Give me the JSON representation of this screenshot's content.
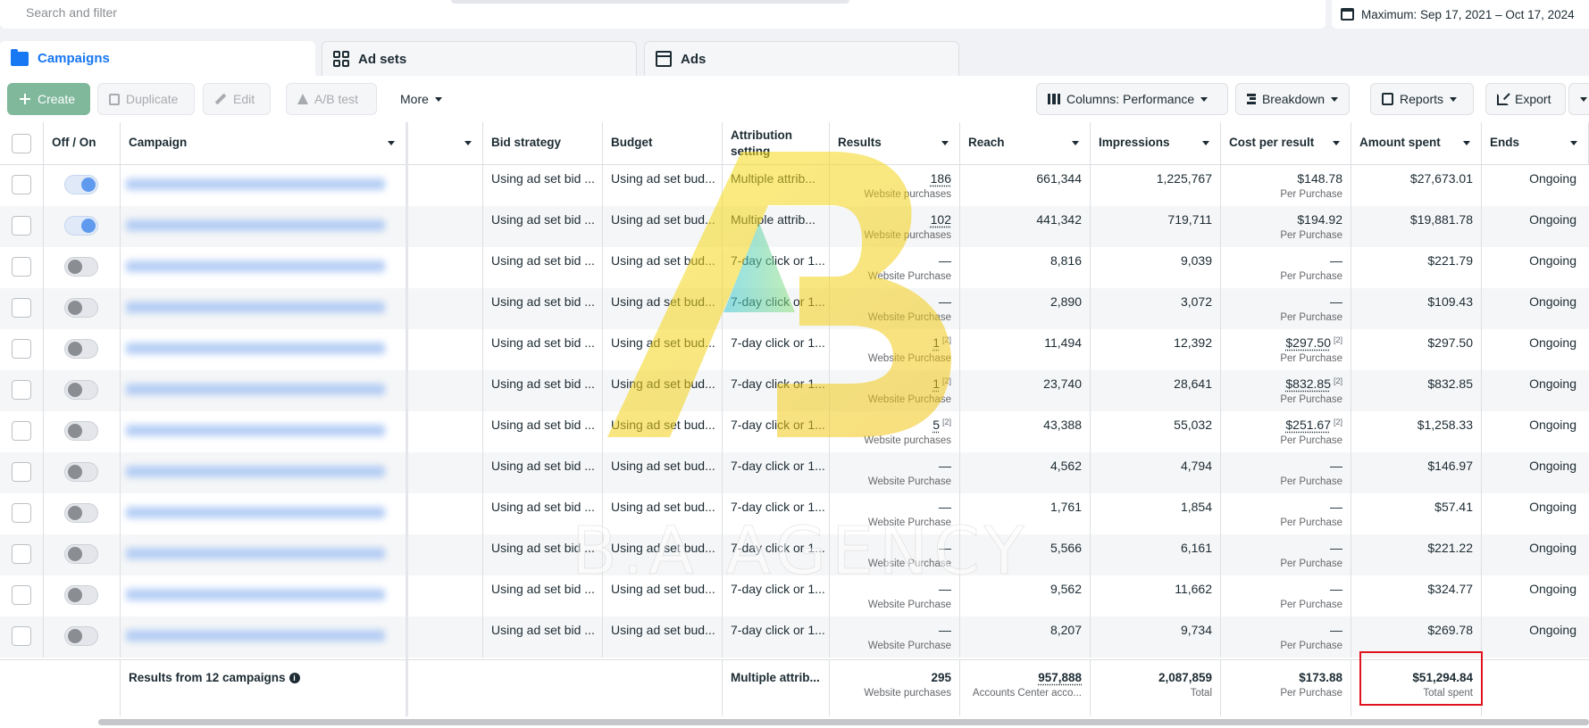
{
  "search": {
    "placeholder": "Search and filter"
  },
  "date_range": {
    "label": "Maximum: Sep 17, 2021 – Oct 17, 2024"
  },
  "tabs": [
    {
      "label": "Campaigns",
      "active": true,
      "icon": "folder-icon"
    },
    {
      "label": "Ad sets",
      "active": false,
      "icon": "grid-icon"
    },
    {
      "label": "Ads",
      "active": false,
      "icon": "page-icon"
    }
  ],
  "toolbar": {
    "create": "Create",
    "duplicate": "Duplicate",
    "edit": "Edit",
    "ab_test": "A/B test",
    "more": "More",
    "columns": "Columns: Performance",
    "breakdown": "Breakdown",
    "reports": "Reports",
    "export": "Export"
  },
  "columns": {
    "off_on": "Off / On",
    "campaign": "Campaign",
    "bid_strategy": "Bid strategy",
    "budget": "Budget",
    "attribution": "Attribution setting",
    "results": "Results",
    "reach": "Reach",
    "impressions": "Impressions",
    "cost_per_result": "Cost per result",
    "amount_spent": "Amount spent",
    "ends": "Ends"
  },
  "rows": [
    {
      "on": true,
      "bid": "Using ad set bid ...",
      "budget": "Using ad set bud...",
      "attribution": "Multiple attrib...",
      "results": "186",
      "results_sup": "",
      "results_sub": "Website purchases",
      "reach": "661,344",
      "impressions": "1,225,767",
      "cpr": "$148.78",
      "cpr_sup": "",
      "cpr_sub": "Per Purchase",
      "spent": "$27,673.01",
      "ends": "Ongoing"
    },
    {
      "on": true,
      "bid": "Using ad set bid ...",
      "budget": "Using ad set bud...",
      "attribution": "Multiple attrib...",
      "results": "102",
      "results_sup": "",
      "results_sub": "Website purchases",
      "reach": "441,342",
      "impressions": "719,711",
      "cpr": "$194.92",
      "cpr_sup": "",
      "cpr_sub": "Per Purchase",
      "spent": "$19,881.78",
      "ends": "Ongoing"
    },
    {
      "on": false,
      "bid": "Using ad set bid ...",
      "budget": "Using ad set bud...",
      "attribution": "7-day click or 1...",
      "results": "—",
      "results_sup": "",
      "results_sub": "Website Purchase",
      "reach": "8,816",
      "impressions": "9,039",
      "cpr": "—",
      "cpr_sup": "",
      "cpr_sub": "Per Purchase",
      "spent": "$221.79",
      "ends": "Ongoing"
    },
    {
      "on": false,
      "bid": "Using ad set bid ...",
      "budget": "Using ad set bud...",
      "attribution": "7-day click or 1...",
      "results": "—",
      "results_sup": "",
      "results_sub": "Website Purchase",
      "reach": "2,890",
      "impressions": "3,072",
      "cpr": "—",
      "cpr_sup": "",
      "cpr_sub": "Per Purchase",
      "spent": "$109.43",
      "ends": "Ongoing"
    },
    {
      "on": false,
      "bid": "Using ad set bid ...",
      "budget": "Using ad set bud...",
      "attribution": "7-day click or 1...",
      "results": "1",
      "results_sup": "[2]",
      "results_sub": "Website Purchase",
      "reach": "11,494",
      "impressions": "12,392",
      "cpr": "$297.50",
      "cpr_sup": "[2]",
      "cpr_sub": "Per Purchase",
      "spent": "$297.50",
      "ends": "Ongoing"
    },
    {
      "on": false,
      "bid": "Using ad set bid ...",
      "budget": "Using ad set bud...",
      "attribution": "7-day click or 1...",
      "results": "1",
      "results_sup": "[2]",
      "results_sub": "Website Purchase",
      "reach": "23,740",
      "impressions": "28,641",
      "cpr": "$832.85",
      "cpr_sup": "[2]",
      "cpr_sub": "Per Purchase",
      "spent": "$832.85",
      "ends": "Ongoing"
    },
    {
      "on": false,
      "bid": "Using ad set bid ...",
      "budget": "Using ad set bud...",
      "attribution": "7-day click or 1...",
      "results": "5",
      "results_sup": "[2]",
      "results_sub": "Website purchases",
      "reach": "43,388",
      "impressions": "55,032",
      "cpr": "$251.67",
      "cpr_sup": "[2]",
      "cpr_sub": "Per Purchase",
      "spent": "$1,258.33",
      "ends": "Ongoing"
    },
    {
      "on": false,
      "bid": "Using ad set bid ...",
      "budget": "Using ad set bud...",
      "attribution": "7-day click or 1...",
      "results": "—",
      "results_sup": "",
      "results_sub": "Website Purchase",
      "reach": "4,562",
      "impressions": "4,794",
      "cpr": "—",
      "cpr_sup": "",
      "cpr_sub": "Per Purchase",
      "spent": "$146.97",
      "ends": "Ongoing"
    },
    {
      "on": false,
      "bid": "Using ad set bid ...",
      "budget": "Using ad set bud...",
      "attribution": "7-day click or 1...",
      "results": "—",
      "results_sup": "",
      "results_sub": "Website Purchase",
      "reach": "1,761",
      "impressions": "1,854",
      "cpr": "—",
      "cpr_sup": "",
      "cpr_sub": "Per Purchase",
      "spent": "$57.41",
      "ends": "Ongoing"
    },
    {
      "on": false,
      "bid": "Using ad set bid ...",
      "budget": "Using ad set bud...",
      "attribution": "7-day click or 1...",
      "results": "—",
      "results_sup": "",
      "results_sub": "Website Purchase",
      "reach": "5,566",
      "impressions": "6,161",
      "cpr": "—",
      "cpr_sup": "",
      "cpr_sub": "Per Purchase",
      "spent": "$221.22",
      "ends": "Ongoing"
    },
    {
      "on": false,
      "bid": "Using ad set bid ...",
      "budget": "Using ad set bud...",
      "attribution": "7-day click or 1...",
      "results": "—",
      "results_sup": "",
      "results_sub": "Website Purchase",
      "reach": "9,562",
      "impressions": "11,662",
      "cpr": "—",
      "cpr_sup": "",
      "cpr_sub": "Per Purchase",
      "spent": "$324.77",
      "ends": "Ongoing"
    },
    {
      "on": false,
      "bid": "Using ad set bid ...",
      "budget": "Using ad set bud...",
      "attribution": "7-day click or 1...",
      "results": "—",
      "results_sup": "",
      "results_sub": "Website Purchase",
      "reach": "8,207",
      "impressions": "9,734",
      "cpr": "—",
      "cpr_sup": "",
      "cpr_sub": "Per Purchase",
      "spent": "$269.78",
      "ends": "Ongoing"
    }
  ],
  "summary": {
    "label": "Results from 12 campaigns",
    "attribution": "Multiple attrib...",
    "results": "295",
    "results_sub": "Website purchases",
    "reach": "957,888",
    "reach_sub": "Accounts Center acco...",
    "impressions": "2,087,859",
    "impressions_sub": "Total",
    "cpr": "$173.88",
    "cpr_sub": "Per Purchase",
    "spent": "$51,294.84",
    "spent_sub": "Total spent"
  },
  "watermark": {
    "text": "B.A AGENCY"
  },
  "colors": {
    "accent": "#1877f2",
    "create_button": "#7fb89b",
    "highlight_box": "#e0141e",
    "watermark_yellow": "#f5d21e"
  }
}
